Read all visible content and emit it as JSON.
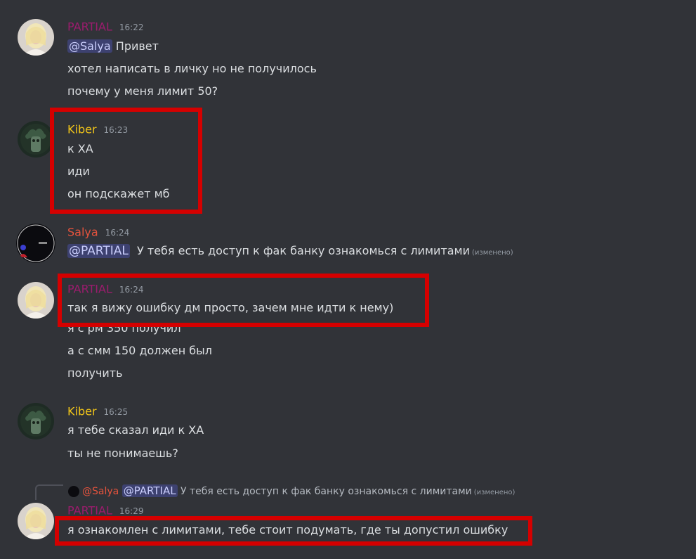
{
  "colors": {
    "background": "#313338",
    "partial": "#9b1c6d",
    "kiber": "#f0c419",
    "salya": "#e5533d",
    "highlight": "#d50000"
  },
  "messages": [
    {
      "user": "PARTIAL",
      "time": "16:22",
      "mention": "@Salya",
      "lines": [
        "Привет",
        "хотел написать в личку но не получилось",
        "почему у меня лимит 50?"
      ]
    },
    {
      "user": "Kiber",
      "time": "16:23",
      "lines": [
        "к ХА",
        "иди",
        "он подскажет мб"
      ]
    },
    {
      "user": "Salya",
      "time": "16:24",
      "mention": "@PARTIAL",
      "lines": [
        "У тебя есть доступ к фак банку ознакомься с лимитами"
      ],
      "edited": "(изменено)"
    },
    {
      "user": "PARTIAL",
      "time": "16:24",
      "lines": [
        "так я вижу ошибку дм просто, зачем мне идти к нему)",
        "я с рм 350 получил",
        "а с смм 150 должен был",
        "получить"
      ]
    },
    {
      "user": "Kiber",
      "time": "16:25",
      "lines": [
        "я тебе сказал иди к ХА",
        "ты не понимаешь?"
      ]
    },
    {
      "user": "PARTIAL",
      "time": "16:29",
      "reply": {
        "user": "@Salya",
        "mention": "@PARTIAL",
        "text": "У тебя есть доступ к фак банку ознакомься с лимитами",
        "edited": "(изменено)"
      },
      "lines": [
        "я ознакомлен с лимитами, тебе стоит подумать, где ты допустил ошибку"
      ]
    }
  ]
}
